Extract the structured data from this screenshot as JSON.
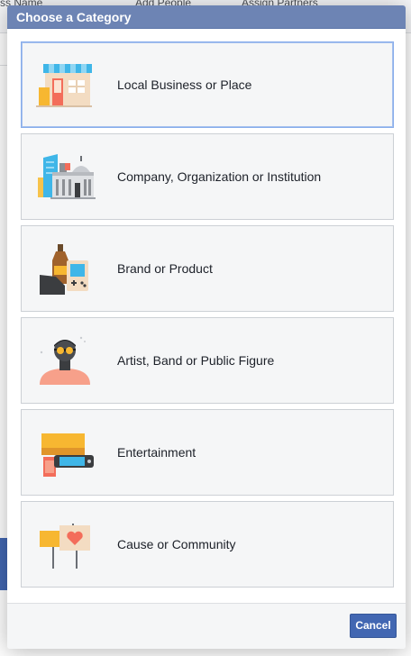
{
  "background": {
    "text_left": "ss Name",
    "add_people_label": "Add People",
    "assign_partners_label": "Assign Partners"
  },
  "dialog": {
    "title": "Choose a Category",
    "categories": [
      {
        "label": "Local Business or Place",
        "icon": "storefront-icon",
        "selected": true
      },
      {
        "label": "Company, Organization or Institution",
        "icon": "buildings-icon",
        "selected": false
      },
      {
        "label": "Brand or Product",
        "icon": "product-icon",
        "selected": false
      },
      {
        "label": "Artist, Band or Public Figure",
        "icon": "person-icon",
        "selected": false
      },
      {
        "label": "Entertainment",
        "icon": "entertainment-icon",
        "selected": false
      },
      {
        "label": "Cause or Community",
        "icon": "cause-signs-icon",
        "selected": false
      }
    ],
    "cancel_label": "Cancel"
  },
  "colors": {
    "header_bg": "#6d84b4",
    "button_bg": "#4267b2",
    "card_bg": "#f5f6f7",
    "selected_border": "#88adeb"
  }
}
